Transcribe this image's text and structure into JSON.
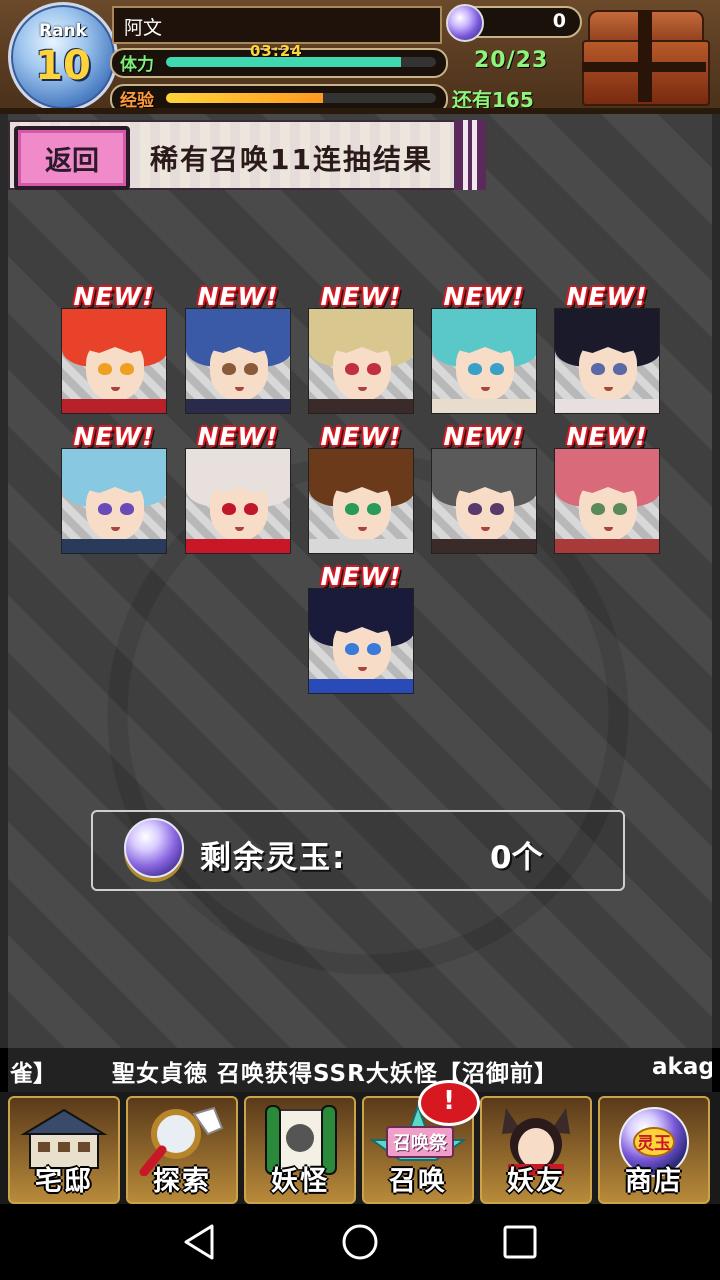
{
  "hud": {
    "rank_label": "Rank",
    "rank_value": "10",
    "player_name": "阿文",
    "stamina_label": "体力",
    "stamina_timer": "03:24",
    "stamina_value": "20/23",
    "stamina_fraction": 0.87,
    "exp_label": "经验",
    "exp_remaining": "还有165",
    "exp_fraction": 0.58,
    "orb_count": "0"
  },
  "header": {
    "back_label": "返回",
    "title": "稀有召唤11连抽结果"
  },
  "results": {
    "new_label": "NEW!",
    "cards": [
      {
        "hair": "#e8432a",
        "eye": "#f0a020",
        "body": "#b8202a"
      },
      {
        "hair": "#3a5aa8",
        "eye": "#8a5a3a",
        "body": "#2a2a4a"
      },
      {
        "hair": "#d8c890",
        "eye": "#c03040",
        "body": "#3a2a2a"
      },
      {
        "hair": "#5ac8c8",
        "eye": "#3aa0c8",
        "body": "#e8dccc"
      },
      {
        "hair": "#1a1a2a",
        "eye": "#5a6aa8",
        "body": "#e8e0e0"
      },
      {
        "hair": "#88c8e0",
        "eye": "#6a4ab8",
        "body": "#2a3a5a"
      },
      {
        "hair": "#e8e0dc",
        "eye": "#c01828",
        "body": "#c81828"
      },
      {
        "hair": "#6a3a1a",
        "eye": "#2a9a5a",
        "body": "#d8d8d8"
      },
      {
        "hair": "#5a5a5a",
        "eye": "#5a3a6a",
        "body": "#3a2a2a"
      },
      {
        "hair": "#d86a7a",
        "eye": "#5a8a5a",
        "body": "#a83a3a"
      },
      {
        "hair": "#1a1a3a",
        "eye": "#3a7ad8",
        "body": "#2a4ab8"
      }
    ]
  },
  "remaining": {
    "label": "剩余灵玉:",
    "value": "0个"
  },
  "ticker": {
    "part1": "雀】",
    "part2": "聖女貞徳 召唤获得SSR大妖怪【沼御前】",
    "part3": "akag"
  },
  "nav": {
    "items": [
      {
        "label": "宅邸"
      },
      {
        "label": "探索"
      },
      {
        "label": "妖怪"
      },
      {
        "label": "召唤"
      },
      {
        "label": "妖友"
      },
      {
        "label": "商店"
      }
    ],
    "badge": "!",
    "festival_label": "召唤祭",
    "shop_orb_label": "灵玉"
  },
  "colors": {
    "stamina_bar": "#3fd8b0",
    "exp_bar": "#ff9a20",
    "new_outline": "#d81820"
  }
}
